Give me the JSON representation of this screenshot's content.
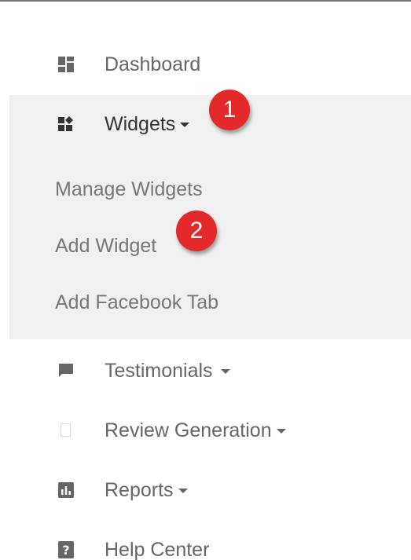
{
  "nav": {
    "dashboard": {
      "label": "Dashboard",
      "icon": "dashboard-icon"
    },
    "widgets": {
      "label": "Widgets",
      "icon": "widgets-icon"
    },
    "widgets_submenu": [
      {
        "label": "Manage Widgets"
      },
      {
        "label": "Add Widget"
      },
      {
        "label": "Add Facebook Tab"
      }
    ],
    "testimonials": {
      "label": "Testimonials",
      "icon": "chat-bubble-icon"
    },
    "review_generation": {
      "label": "Review Generation",
      "icon": "blank-square-icon"
    },
    "reports": {
      "label": "Reports",
      "icon": "bar-chart-icon"
    },
    "help_center": {
      "label": "Help Center",
      "icon": "help-icon"
    }
  },
  "annotations": {
    "step1": "1",
    "step2": "2"
  },
  "colors": {
    "badge": "#e3292a",
    "submenu_background": "#f0f0f0",
    "text_muted": "#666666",
    "text_active": "#333333"
  }
}
